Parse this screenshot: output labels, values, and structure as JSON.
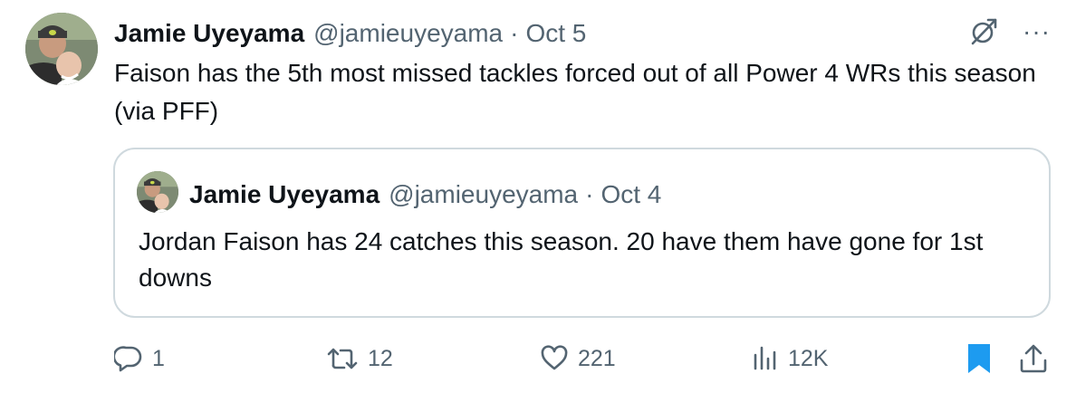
{
  "tweet": {
    "author_name": "Jamie Uyeyama",
    "handle": "@jamieuyeyama",
    "separator": "·",
    "date": "Oct 5",
    "text": "Faison has the 5th most missed tackles forced out of all Power 4 WRs this season (via PFF)"
  },
  "quoted": {
    "author_name": "Jamie Uyeyama",
    "handle": "@jamieuyeyama",
    "separator": "·",
    "date": "Oct 4",
    "text": "Jordan Faison has 24 catches this season. 20 have them have gone for 1st downs"
  },
  "icons": {
    "grok": "grok-icon",
    "more": "···",
    "reply": "reply-icon",
    "retweet": "retweet-icon",
    "like": "heart-icon",
    "views": "views-icon",
    "bookmark": "bookmark-icon",
    "share": "share-icon"
  },
  "actions": {
    "replies": "1",
    "retweets": "12",
    "likes": "221",
    "views": "12K"
  },
  "colors": {
    "text": "#0f1419",
    "secondary": "#536471",
    "border": "#cfd9de",
    "bookmark_active": "#1d9bf0"
  }
}
